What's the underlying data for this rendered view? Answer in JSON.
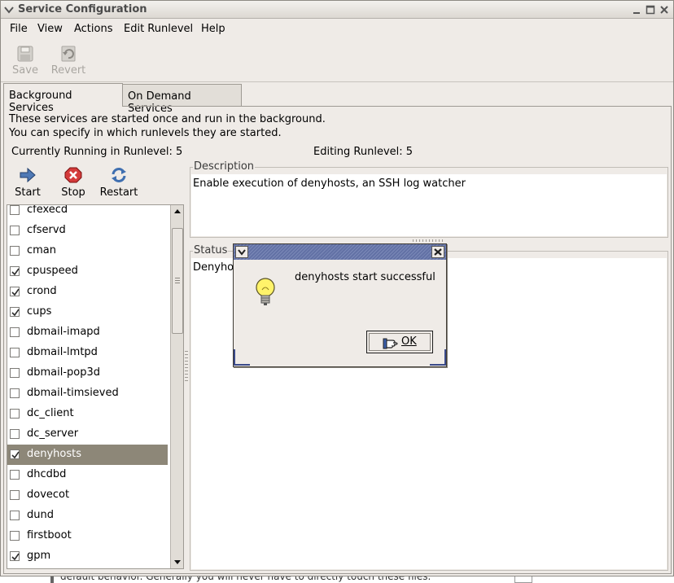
{
  "window": {
    "title": "Service Configuration"
  },
  "menubar": {
    "items": [
      "File",
      "View",
      "Actions",
      "Edit Runlevel",
      "Help"
    ]
  },
  "toolbar": {
    "save_label": "Save",
    "revert_label": "Revert"
  },
  "tabs": [
    {
      "label": "Background Services",
      "active": true
    },
    {
      "label": "On Demand Services",
      "active": false
    }
  ],
  "info": {
    "line1": "These services are started once and run in the background.",
    "line2": "You can specify in which runlevels they are started.",
    "running": "Currently Running in Runlevel: 5",
    "editing": "Editing Runlevel: 5"
  },
  "actions": {
    "start": "Start",
    "stop": "Stop",
    "restart": "Restart"
  },
  "services": [
    {
      "name": "cfexecd",
      "checked": false,
      "selected": false
    },
    {
      "name": "cfservd",
      "checked": false,
      "selected": false
    },
    {
      "name": "cman",
      "checked": false,
      "selected": false
    },
    {
      "name": "cpuspeed",
      "checked": true,
      "selected": false
    },
    {
      "name": "crond",
      "checked": true,
      "selected": false
    },
    {
      "name": "cups",
      "checked": true,
      "selected": false
    },
    {
      "name": "dbmail-imapd",
      "checked": false,
      "selected": false
    },
    {
      "name": "dbmail-lmtpd",
      "checked": false,
      "selected": false
    },
    {
      "name": "dbmail-pop3d",
      "checked": false,
      "selected": false
    },
    {
      "name": "dbmail-timsieved",
      "checked": false,
      "selected": false
    },
    {
      "name": "dc_client",
      "checked": false,
      "selected": false
    },
    {
      "name": "dc_server",
      "checked": false,
      "selected": false
    },
    {
      "name": "denyhosts",
      "checked": true,
      "selected": true
    },
    {
      "name": "dhcdbd",
      "checked": false,
      "selected": false
    },
    {
      "name": "dovecot",
      "checked": false,
      "selected": false
    },
    {
      "name": "dund",
      "checked": false,
      "selected": false
    },
    {
      "name": "firstboot",
      "checked": false,
      "selected": false
    },
    {
      "name": "gpm",
      "checked": true,
      "selected": false
    }
  ],
  "description": {
    "label": "Description",
    "text": "Enable execution of denyhosts, an SSH log watcher"
  },
  "status": {
    "label": "Status",
    "text": "Denyho"
  },
  "dialog": {
    "message": "denyhosts start successful",
    "ok_label": "OK"
  },
  "background_text": "default behavior. Generally you will never have to directly touch these files."
}
